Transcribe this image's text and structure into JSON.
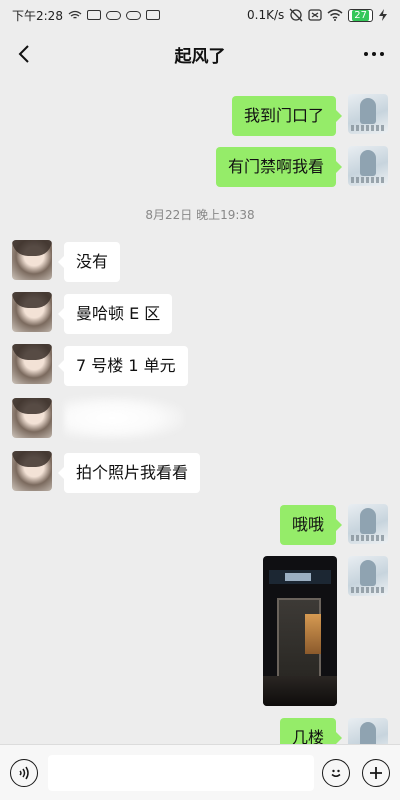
{
  "status": {
    "time": "下午2:28",
    "network_speed": "0.1K/s",
    "battery": "27"
  },
  "nav": {
    "title": "起风了"
  },
  "messages": {
    "m1": "我到门口了",
    "m2": "有门禁啊我看",
    "timestamp": "8月22日 晚上19:38",
    "m3": "没有",
    "m4": "曼哈顿 E 区",
    "m5": "7 号楼 1 单元",
    "m6": "拍个照片我看看",
    "m7": "哦哦",
    "m8": "几楼"
  },
  "icons": {
    "back": "chevron-left-icon",
    "more": "more-dots-icon",
    "voice": "voice-icon",
    "emoji": "emoji-icon",
    "plus": "plus-icon"
  },
  "colors": {
    "bubble_out": "#95ec69",
    "bubble_in": "#ffffff",
    "background": "#ededed"
  }
}
